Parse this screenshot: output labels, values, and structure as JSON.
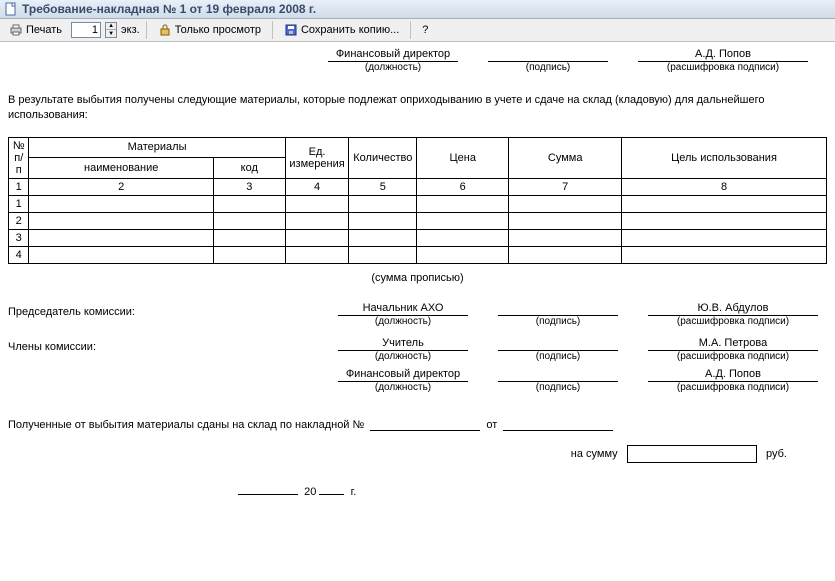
{
  "titlebar": {
    "title": "Требование-накладная № 1 от 19 февраля 2008 г."
  },
  "toolbar": {
    "print": "Печать",
    "copies_value": "1",
    "copies_suffix": "экз.",
    "view_only": "Только просмотр",
    "save_copy": "Сохранить копию...",
    "help": "?"
  },
  "top_sig": {
    "position_value": "Финансовый директор",
    "position_caption": "(должность)",
    "sign_caption": "(подпись)",
    "name_value": "А.Д. Попов",
    "name_caption": "(расшифровка подписи)"
  },
  "paragraph": "В результате выбытия получены следующие материалы, которые подлежат оприходыванию в учете и сдаче на склад (кладовую) для дальнейшего использования:",
  "table": {
    "headers": {
      "npp": "№ п/п",
      "materials": "Материалы",
      "unit": "Ед. измерения",
      "qty": "Количество",
      "price": "Цена",
      "sum": "Сумма",
      "purpose": "Цель использования",
      "name_sub": "наименование",
      "code_sub": "код"
    },
    "numrow": [
      "1",
      "2",
      "3",
      "4",
      "5",
      "6",
      "7",
      "8"
    ],
    "rows": [
      {
        "n": "1"
      },
      {
        "n": "2"
      },
      {
        "n": "3"
      },
      {
        "n": "4"
      }
    ]
  },
  "sum_words_caption": "(сумма прописью)",
  "commission": {
    "chair_label": "Председатель комиссии:",
    "members_label": "Члены комиссии:",
    "lines": [
      {
        "pos": "Начальник АХО",
        "name": "Ю.В. Абдулов"
      },
      {
        "pos": "Учитель",
        "name": "М.А. Петрова"
      },
      {
        "pos": "Финансовый директор",
        "name": "А.Д. Попов"
      }
    ],
    "pos_caption": "(должность)",
    "sign_caption": "(подпись)",
    "name_caption": "(расшифровка подписи)"
  },
  "handover": {
    "prefix": "Полученные от выбытия материалы сданы на склад по накладной №",
    "from_label": "от"
  },
  "sum_line": {
    "label": "на сумму",
    "suffix": "руб."
  },
  "date": {
    "century": "20",
    "year_suffix": "г."
  }
}
